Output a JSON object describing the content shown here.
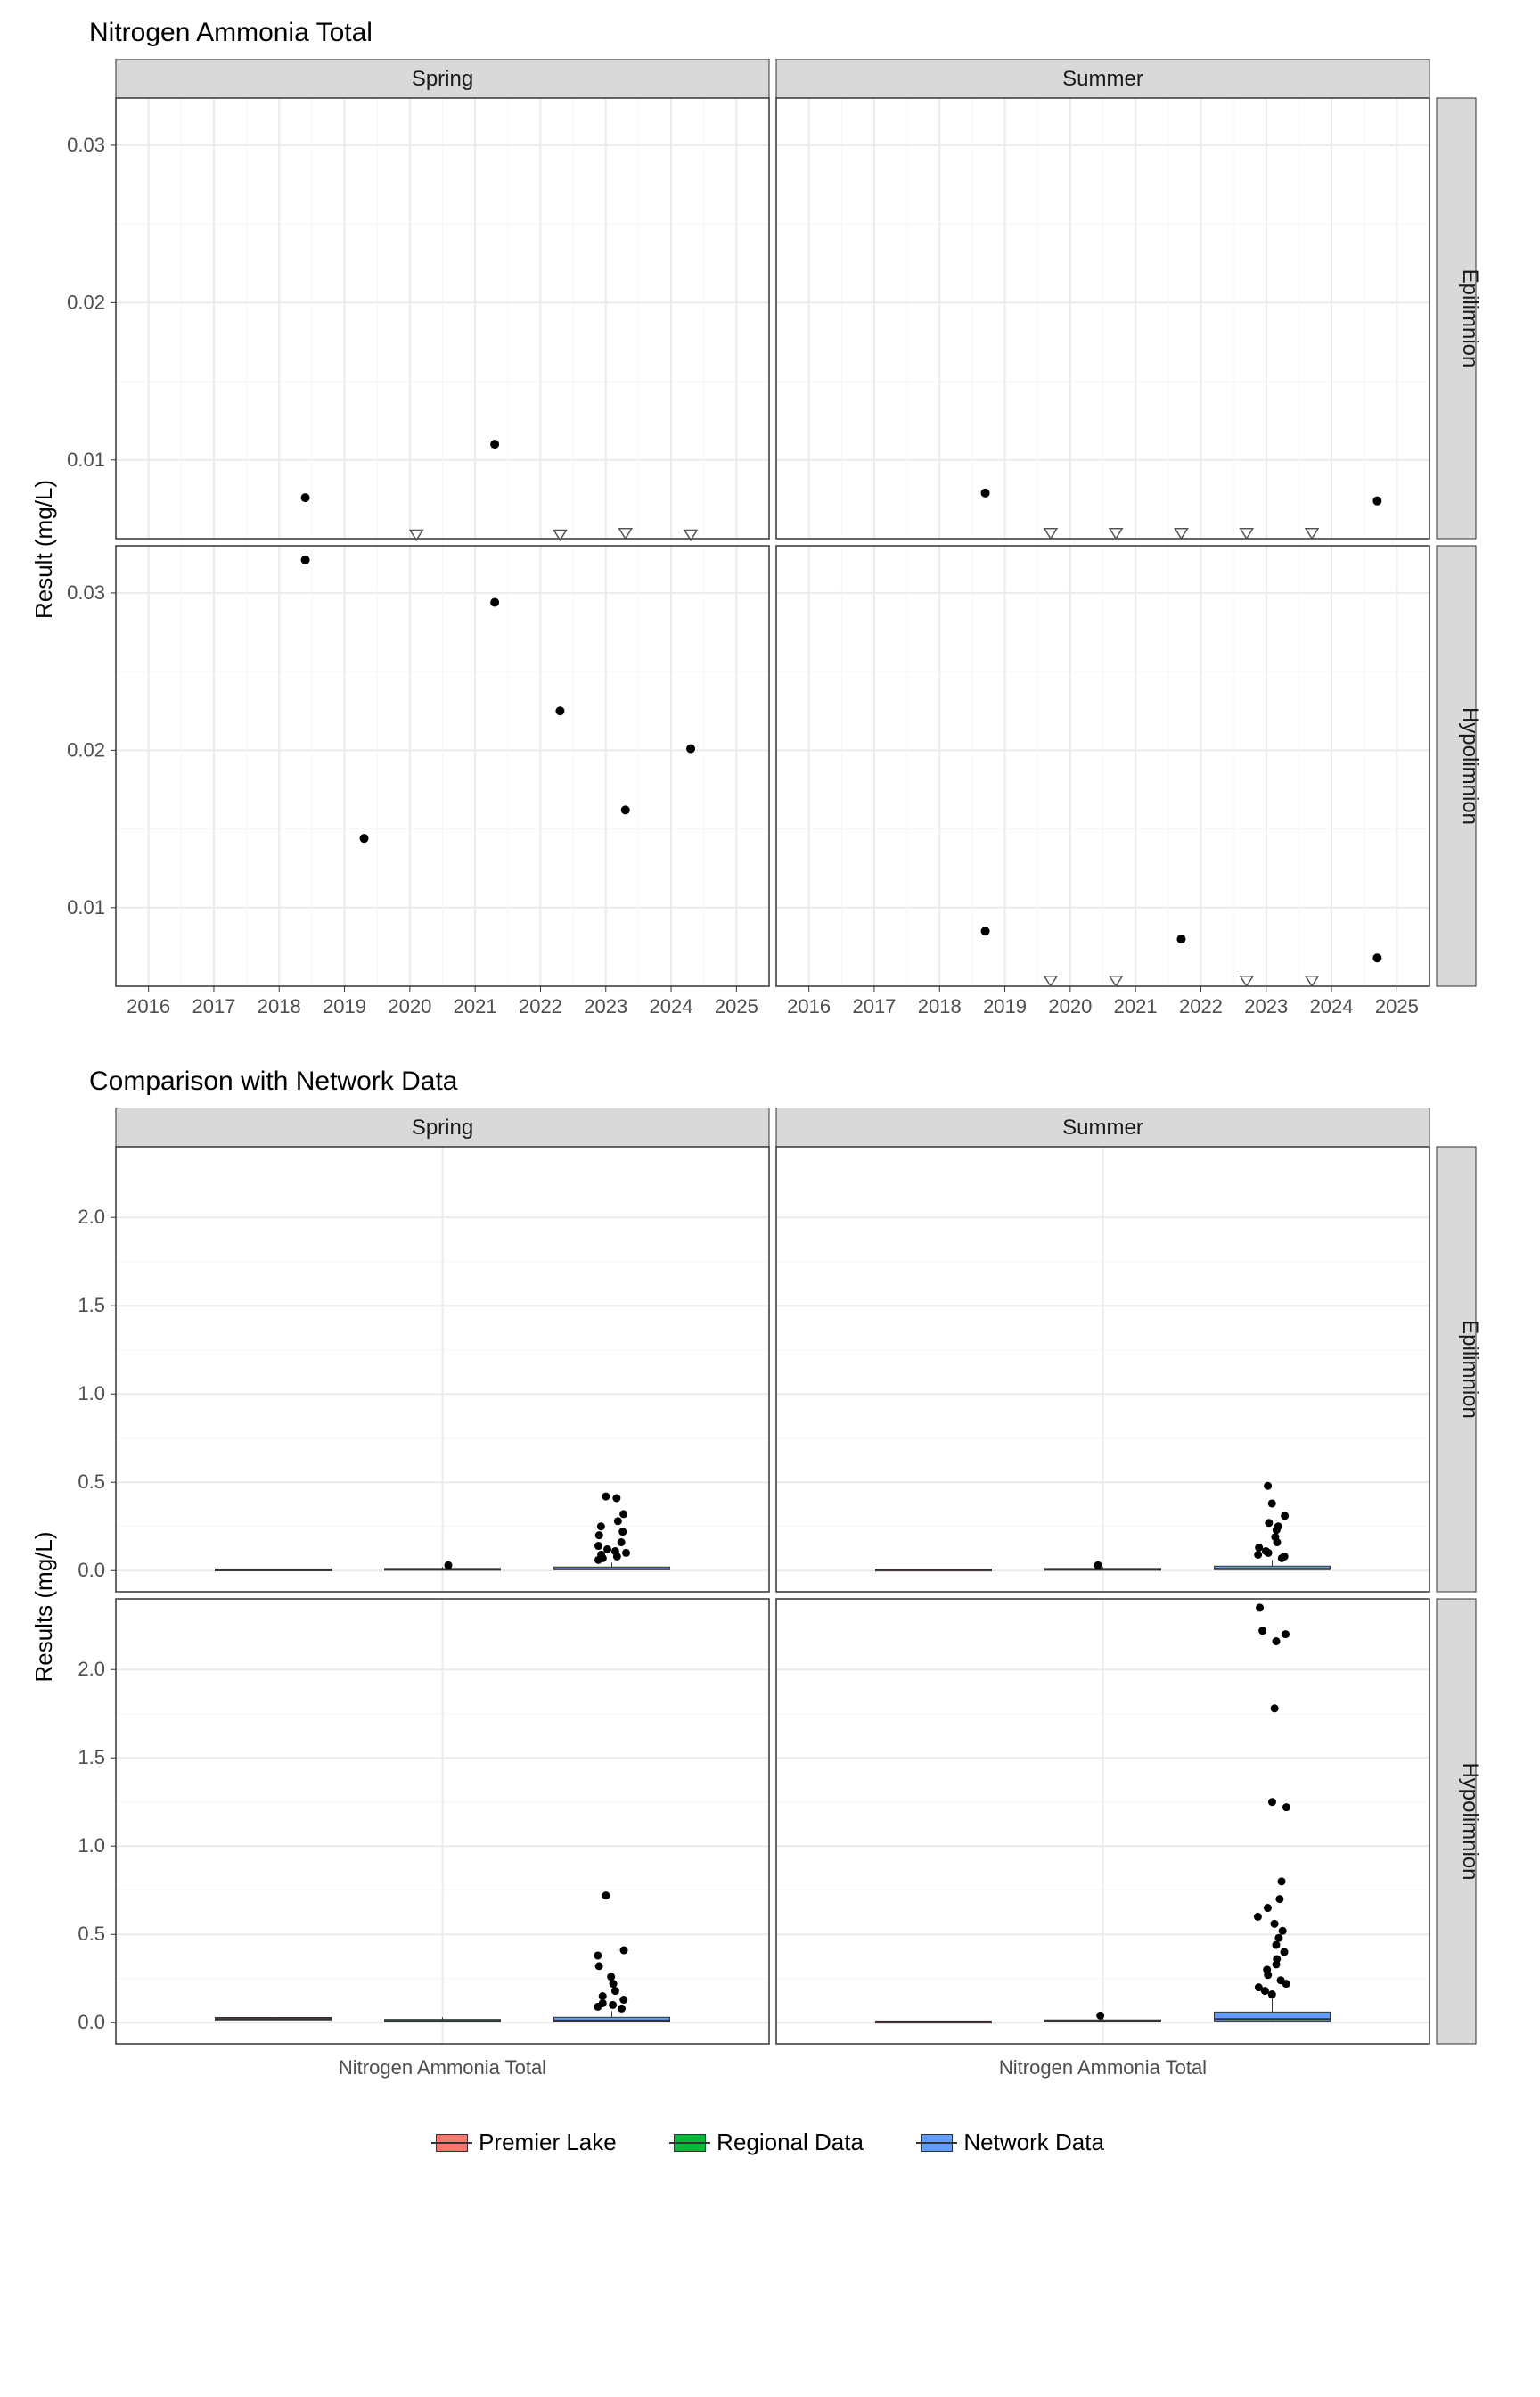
{
  "titles": {
    "chart1": "Nitrogen Ammonia Total",
    "chart2": "Comparison with Network Data"
  },
  "axis": {
    "chart1_y": "Result (mg/L)",
    "chart2_y": "Results (mg/L)"
  },
  "legend": {
    "premier": "Premier Lake",
    "regional": "Regional Data",
    "network": "Network Data"
  },
  "facets": {
    "cols": [
      "Spring",
      "Summer"
    ],
    "rows": [
      "Epilimnion",
      "Hypolimnion"
    ]
  },
  "chart_data": [
    {
      "id": "chart1",
      "type": "scatter",
      "title": "Nitrogen Ammonia Total",
      "xlabel": "",
      "ylabel": "Result (mg/L)",
      "x_ticks": [
        2016,
        2017,
        2018,
        2019,
        2020,
        2021,
        2022,
        2023,
        2024,
        2025
      ],
      "panels": [
        {
          "col": "Spring",
          "row": "Epilimnion",
          "ylim": [
            0.005,
            0.033
          ],
          "y_ticks": [
            0.01,
            0.02,
            0.03
          ],
          "points": [
            {
              "x": 2018.4,
              "y": 0.0076
            },
            {
              "x": 2021.3,
              "y": 0.011
            }
          ],
          "censored": [
            {
              "x": 2020.1,
              "y": 0.0053
            },
            {
              "x": 2022.3,
              "y": 0.0053
            },
            {
              "x": 2023.3,
              "y": 0.0054
            },
            {
              "x": 2024.3,
              "y": 0.0053
            }
          ]
        },
        {
          "col": "Summer",
          "row": "Epilimnion",
          "ylim": [
            0.005,
            0.033
          ],
          "y_ticks": [
            0.01,
            0.02,
            0.03
          ],
          "points": [
            {
              "x": 2018.7,
              "y": 0.0079
            },
            {
              "x": 2024.7,
              "y": 0.0074
            }
          ],
          "censored": [
            {
              "x": 2019.7,
              "y": 0.0054
            },
            {
              "x": 2020.7,
              "y": 0.0054
            },
            {
              "x": 2021.7,
              "y": 0.0054
            },
            {
              "x": 2022.7,
              "y": 0.0054
            },
            {
              "x": 2023.7,
              "y": 0.0054
            }
          ]
        },
        {
          "col": "Spring",
          "row": "Hypolimnion",
          "ylim": [
            0.005,
            0.033
          ],
          "y_ticks": [
            0.01,
            0.02,
            0.03
          ],
          "points": [
            {
              "x": 2018.4,
              "y": 0.0321
            },
            {
              "x": 2019.3,
              "y": 0.0144
            },
            {
              "x": 2021.3,
              "y": 0.0294
            },
            {
              "x": 2022.3,
              "y": 0.0225
            },
            {
              "x": 2023.3,
              "y": 0.0162
            },
            {
              "x": 2024.3,
              "y": 0.0201
            }
          ],
          "censored": []
        },
        {
          "col": "Summer",
          "row": "Hypolimnion",
          "ylim": [
            0.005,
            0.033
          ],
          "y_ticks": [
            0.01,
            0.02,
            0.03
          ],
          "points": [
            {
              "x": 2018.7,
              "y": 0.0085
            },
            {
              "x": 2021.7,
              "y": 0.008
            },
            {
              "x": 2024.7,
              "y": 0.0068
            }
          ],
          "censored": [
            {
              "x": 2019.7,
              "y": 0.0054
            },
            {
              "x": 2020.7,
              "y": 0.0054
            },
            {
              "x": 2022.7,
              "y": 0.0054
            },
            {
              "x": 2023.7,
              "y": 0.0054
            }
          ]
        }
      ]
    },
    {
      "id": "chart2",
      "type": "boxplot",
      "title": "Comparison with Network Data",
      "xlabel": "",
      "ylabel": "Results (mg/L)",
      "x_categories": [
        "Nitrogen Ammonia Total"
      ],
      "groups": [
        "Premier Lake",
        "Regional Data",
        "Network Data"
      ],
      "colors": {
        "Premier Lake": "#F8766D",
        "Regional Data": "#00BA38",
        "Network Data": "#619CFF"
      },
      "ylim": [
        -0.12,
        2.4
      ],
      "y_ticks": [
        0.0,
        0.5,
        1.0,
        1.5,
        2.0
      ],
      "panels": [
        {
          "col": "Spring",
          "row": "Epilimnion",
          "boxes": [
            {
              "group": "Premier Lake",
              "q1": 0.005,
              "median": 0.006,
              "q3": 0.009,
              "lw": 0.005,
              "uw": 0.011,
              "outliers": []
            },
            {
              "group": "Regional Data",
              "q1": 0.005,
              "median": 0.007,
              "q3": 0.012,
              "lw": 0.005,
              "uw": 0.02,
              "outliers": [
                0.03
              ]
            },
            {
              "group": "Network Data",
              "q1": 0.005,
              "median": 0.008,
              "q3": 0.02,
              "lw": 0.005,
              "uw": 0.045,
              "outliers": [
                0.06,
                0.07,
                0.08,
                0.09,
                0.1,
                0.11,
                0.12,
                0.14,
                0.16,
                0.2,
                0.22,
                0.25,
                0.28,
                0.32,
                0.41,
                0.42
              ]
            }
          ]
        },
        {
          "col": "Summer",
          "row": "Epilimnion",
          "boxes": [
            {
              "group": "Premier Lake",
              "q1": 0.005,
              "median": 0.006,
              "q3": 0.008,
              "lw": 0.005,
              "uw": 0.008,
              "outliers": []
            },
            {
              "group": "Regional Data",
              "q1": 0.005,
              "median": 0.007,
              "q3": 0.012,
              "lw": 0.005,
              "uw": 0.02,
              "outliers": [
                0.03
              ]
            },
            {
              "group": "Network Data",
              "q1": 0.005,
              "median": 0.01,
              "q3": 0.025,
              "lw": 0.005,
              "uw": 0.06,
              "outliers": [
                0.07,
                0.08,
                0.09,
                0.1,
                0.11,
                0.13,
                0.16,
                0.19,
                0.23,
                0.25,
                0.27,
                0.31,
                0.38,
                0.48
              ]
            }
          ]
        },
        {
          "col": "Spring",
          "row": "Hypolimnion",
          "boxes": [
            {
              "group": "Premier Lake",
              "q1": 0.015,
              "median": 0.021,
              "q3": 0.029,
              "lw": 0.014,
              "uw": 0.032,
              "outliers": []
            },
            {
              "group": "Regional Data",
              "q1": 0.006,
              "median": 0.01,
              "q3": 0.018,
              "lw": 0.005,
              "uw": 0.03,
              "outliers": []
            },
            {
              "group": "Network Data",
              "q1": 0.006,
              "median": 0.012,
              "q3": 0.03,
              "lw": 0.005,
              "uw": 0.065,
              "outliers": [
                0.08,
                0.09,
                0.1,
                0.11,
                0.13,
                0.15,
                0.18,
                0.22,
                0.26,
                0.32,
                0.38,
                0.41,
                0.72
              ]
            }
          ]
        },
        {
          "col": "Summer",
          "row": "Hypolimnion",
          "boxes": [
            {
              "group": "Premier Lake",
              "q1": 0.005,
              "median": 0.007,
              "q3": 0.008,
              "lw": 0.005,
              "uw": 0.009,
              "outliers": []
            },
            {
              "group": "Regional Data",
              "q1": 0.005,
              "median": 0.008,
              "q3": 0.015,
              "lw": 0.005,
              "uw": 0.025,
              "outliers": [
                0.04
              ]
            },
            {
              "group": "Network Data",
              "q1": 0.008,
              "median": 0.02,
              "q3": 0.06,
              "lw": 0.005,
              "uw": 0.14,
              "outliers": [
                0.16,
                0.18,
                0.2,
                0.22,
                0.24,
                0.27,
                0.3,
                0.33,
                0.36,
                0.4,
                0.44,
                0.48,
                0.52,
                0.56,
                0.6,
                0.65,
                0.7,
                0.8,
                1.22,
                1.25,
                1.78,
                2.16,
                2.2,
                2.22,
                2.35
              ]
            }
          ]
        }
      ]
    }
  ]
}
